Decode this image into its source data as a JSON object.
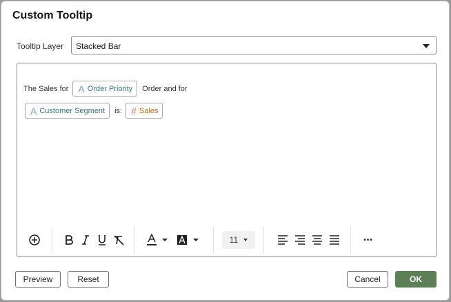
{
  "dialog": {
    "title": "Custom Tooltip"
  },
  "layer": {
    "label": "Tooltip Layer",
    "selected": "Stacked Bar"
  },
  "editor": {
    "line1": {
      "text_before": "The Sales for",
      "chip": "Order Priority",
      "text_after": "Order and for"
    },
    "line2": {
      "chip": "Customer Segment",
      "text_mid": "is:",
      "measure_chip": "Sales"
    }
  },
  "toolbar": {
    "font_size": "11",
    "more": "•••",
    "icons": [
      "insert-icon",
      "bold-icon",
      "italic-icon",
      "underline-icon",
      "clear-format-icon",
      "text-color-icon",
      "highlight-color-icon",
      "align-left-icon",
      "align-right-icon",
      "align-center-icon",
      "justify-icon",
      "more-icon"
    ]
  },
  "footer": {
    "preview": "Preview",
    "reset": "Reset",
    "cancel": "Cancel",
    "ok": "OK"
  },
  "colors": {
    "ok_button": "#5c7f55",
    "attribute_chip": "#2f7d76",
    "measure_chip": "#c56a0e"
  }
}
